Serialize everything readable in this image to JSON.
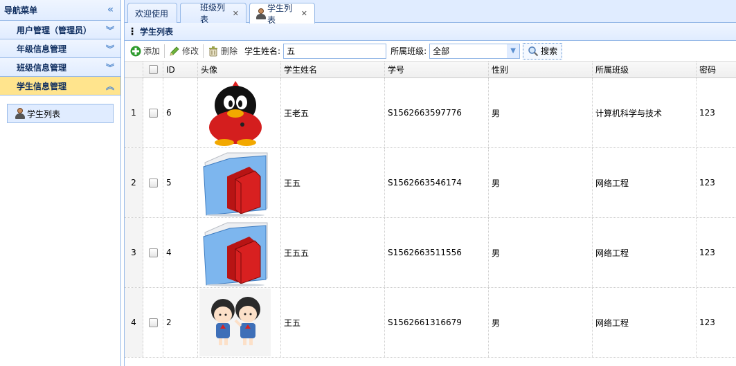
{
  "nav": {
    "title": "导航菜单",
    "groups": [
      {
        "label": "用户管理（管理员）"
      },
      {
        "label": "年级信息管理"
      },
      {
        "label": "班级信息管理"
      },
      {
        "label": "学生信息管理"
      }
    ],
    "items": [
      {
        "label": "学生列表"
      }
    ]
  },
  "tabs": [
    {
      "label": "欢迎使用"
    },
    {
      "label": "班级列表"
    },
    {
      "label": "学生列表"
    }
  ],
  "panel": {
    "title": "学生列表"
  },
  "toolbar": {
    "add_label": "添加",
    "edit_label": "修改",
    "delete_label": "删除",
    "name_label": "学生姓名:",
    "name_value": "五",
    "class_label": "所属班级:",
    "class_value": "全部",
    "search_label": "搜索"
  },
  "grid": {
    "headers": {
      "id": "ID",
      "avatar": "头像",
      "name": "学生姓名",
      "sn": "学号",
      "sex": "性别",
      "clazz": "所属班级",
      "password": "密码"
    },
    "rows": [
      {
        "rownum": "1",
        "id": "6",
        "avatar": "qq-penguin",
        "name": "王老五",
        "sn": "S1562663597776",
        "sex": "男",
        "clazz": "计算机科学与技术",
        "password": "123"
      },
      {
        "rownum": "2",
        "id": "5",
        "avatar": "folder-book",
        "name": "王五",
        "sn": "S1562663546174",
        "sex": "男",
        "clazz": "网络工程",
        "password": "123"
      },
      {
        "rownum": "3",
        "id": "4",
        "avatar": "folder-book",
        "name": "王五五",
        "sn": "S1562663511556",
        "sex": "男",
        "clazz": "网络工程",
        "password": "123"
      },
      {
        "rownum": "4",
        "id": "2",
        "avatar": "cartoon-kids",
        "name": "王五",
        "sn": "S1562661316679",
        "sex": "男",
        "clazz": "网络工程",
        "password": "123"
      }
    ]
  },
  "colors": {
    "accent": "#95B8E7",
    "active_group": "#FFE48D",
    "header_bg": "#E0ECFF"
  }
}
